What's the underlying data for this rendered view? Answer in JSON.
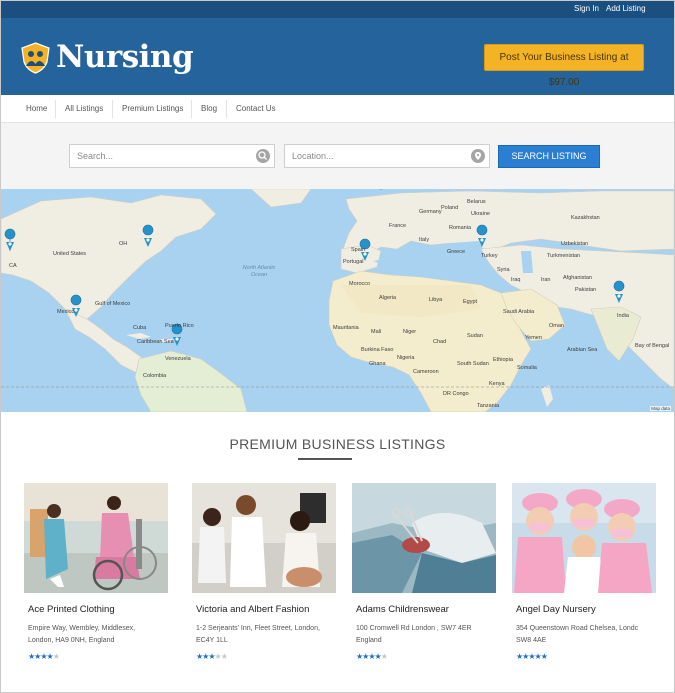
{
  "colors": {
    "topbar": "#1b4f80",
    "header": "#24639c",
    "accent_button": "#f3b325",
    "search_button": "#2a7fd3",
    "stars": "#1f6fc2"
  },
  "topbar": {
    "sign_in": "Sign In",
    "add_listing": "Add Listing"
  },
  "header": {
    "logo_text": "Nursing",
    "logo_icon": "nurse-emblem-icon",
    "post_button": "Post Your Business Listing at $97.00"
  },
  "nav": {
    "items": [
      "Home",
      "All Listings",
      "Premium Listings",
      "Blog",
      "Contact Us"
    ]
  },
  "search": {
    "keyword_placeholder": "Search...",
    "location_placeholder": "Location...",
    "button": "SEARCH LISTING"
  },
  "map": {
    "labels": {
      "united_states": "United States",
      "mexico": "Mexico",
      "venezuela": "Venezuela",
      "colombia": "Colombia",
      "puerto_rico": "Puerto Rico",
      "caribbean": "Caribbean Sea",
      "gulf_mexico": "Gulf of Mexico",
      "north_atlantic": "North Atlantic Ocean",
      "portugal": "Portugal",
      "morocco": "Morocco",
      "algeria": "Algeria",
      "libya": "Libya",
      "egypt": "Egypt",
      "mali": "Mali",
      "niger": "Niger",
      "chad": "Chad",
      "sudan": "Sudan",
      "nigeria": "Nigeria",
      "ethiopia": "Ethiopia",
      "kenya": "Kenya",
      "tanzania": "Tanzania",
      "mauritania": "Mauritania",
      "turkey": "Turkey",
      "iran": "Iran",
      "iraq": "Iraq",
      "saudi_arabia": "Saudi Arabia",
      "kazakhstan": "Kazakhstan",
      "afghanistan": "Afghanistan",
      "pakistan": "Pakistan",
      "india": "India",
      "turkmenistan": "Turkmenistan",
      "uzbekistan": "Uzbekistan",
      "ukraine": "Ukraine",
      "poland": "Poland",
      "france": "France",
      "spain": "Spain",
      "italy": "Italy",
      "romania": "Romania",
      "germany": "Germany",
      "belarus": "Belarus",
      "south_sudan": "South Sudan",
      "yemen": "Yemen",
      "oman": "Oman",
      "arabian_sea": "Arabian Sea",
      "bay_bengal": "Bay of Bengal",
      "dr_congo": "DR Congo",
      "ca": "CA",
      "ohio": "OH",
      "cuba": "Cuba",
      "greece": "Greece",
      "syria": "Syria",
      "burkina": "Burkina Faso",
      "ghana": "Ghana",
      "cameroon": "Cameroon",
      "somalia": "Somalia"
    },
    "credit": "Map data"
  },
  "premium": {
    "title": "PREMIUM BUSINESS LISTINGS",
    "listings": [
      {
        "name": "Ace Printed Clothing",
        "address_line1": "Empire Way, Wembley, Middlesex,",
        "address_line2": "London, HA9 0NH, England",
        "rating": 4,
        "max_rating": 5
      },
      {
        "name": "Victoria and Albert Fashion",
        "address_line1": "1-2 Serjeants' Inn, Fleet Street, London,",
        "address_line2": "EC4Y 1LL",
        "rating": 3,
        "max_rating": 5
      },
      {
        "name": "Adams Childrenswear",
        "address_line1": "100 Cromwell Rd London , SW7 4ER",
        "address_line2": "England",
        "rating": 4,
        "max_rating": 5
      },
      {
        "name": "Angel Day Nursery",
        "address_line1": "354 Queenstown Road Chelsea, Londc",
        "address_line2": "SW8 4AE",
        "rating": 5,
        "max_rating": 5
      }
    ]
  }
}
